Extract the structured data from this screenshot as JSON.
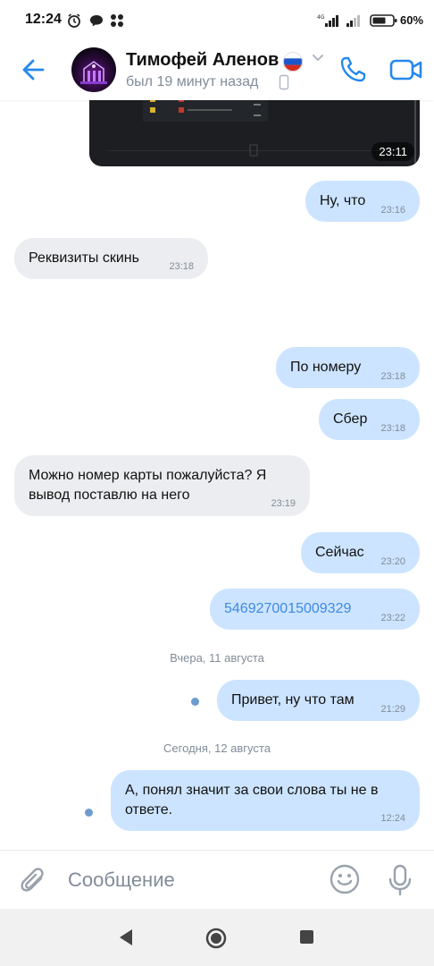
{
  "status_bar": {
    "time": "12:24",
    "battery": "60%",
    "icons": [
      "alarm-icon",
      "chat-bubble-icon",
      "app-dots-icon",
      "signal-4g-icon",
      "signal-icon",
      "battery-icon"
    ]
  },
  "header": {
    "contact_name": "Тимофей Аленов",
    "last_seen": "был 19 минут назад",
    "flag": "russia-flag",
    "accent_color": "#2688eb"
  },
  "media": {
    "time": "23:11"
  },
  "messages": [
    {
      "direction": "out",
      "text": "Ну, что",
      "time": "23:16"
    },
    {
      "direction": "in",
      "text": "Реквизиты скинь",
      "time": "23:18"
    },
    {
      "direction": "out",
      "text": "По номеру",
      "time": "23:18"
    },
    {
      "direction": "out",
      "text": "Сбер",
      "time": "23:18"
    },
    {
      "direction": "in",
      "text": "Можно номер карты пожалуйста? Я вывод поставлю на него",
      "time": "23:19"
    },
    {
      "direction": "out",
      "text": "Сейчас",
      "time": "23:20"
    },
    {
      "direction": "out",
      "text": "5469270015009329",
      "time": "23:22",
      "is_link": true
    },
    {
      "direction": "out",
      "text": "Привет, ну что там",
      "time": "21:29",
      "unread": true
    },
    {
      "direction": "out",
      "text": "А, понял значит за свои слова ты не в ответе.",
      "time": "12:24",
      "unread": true
    }
  ],
  "date_separators": [
    "Вчера, 11 августа",
    "Сегодня, 12 августа"
  ],
  "composer": {
    "placeholder": "Сообщение"
  },
  "colors": {
    "incoming_bubble": "#ebedf0",
    "outgoing_bubble": "#cce4ff",
    "link": "#3f8ae0",
    "secondary_text": "#818c99"
  }
}
